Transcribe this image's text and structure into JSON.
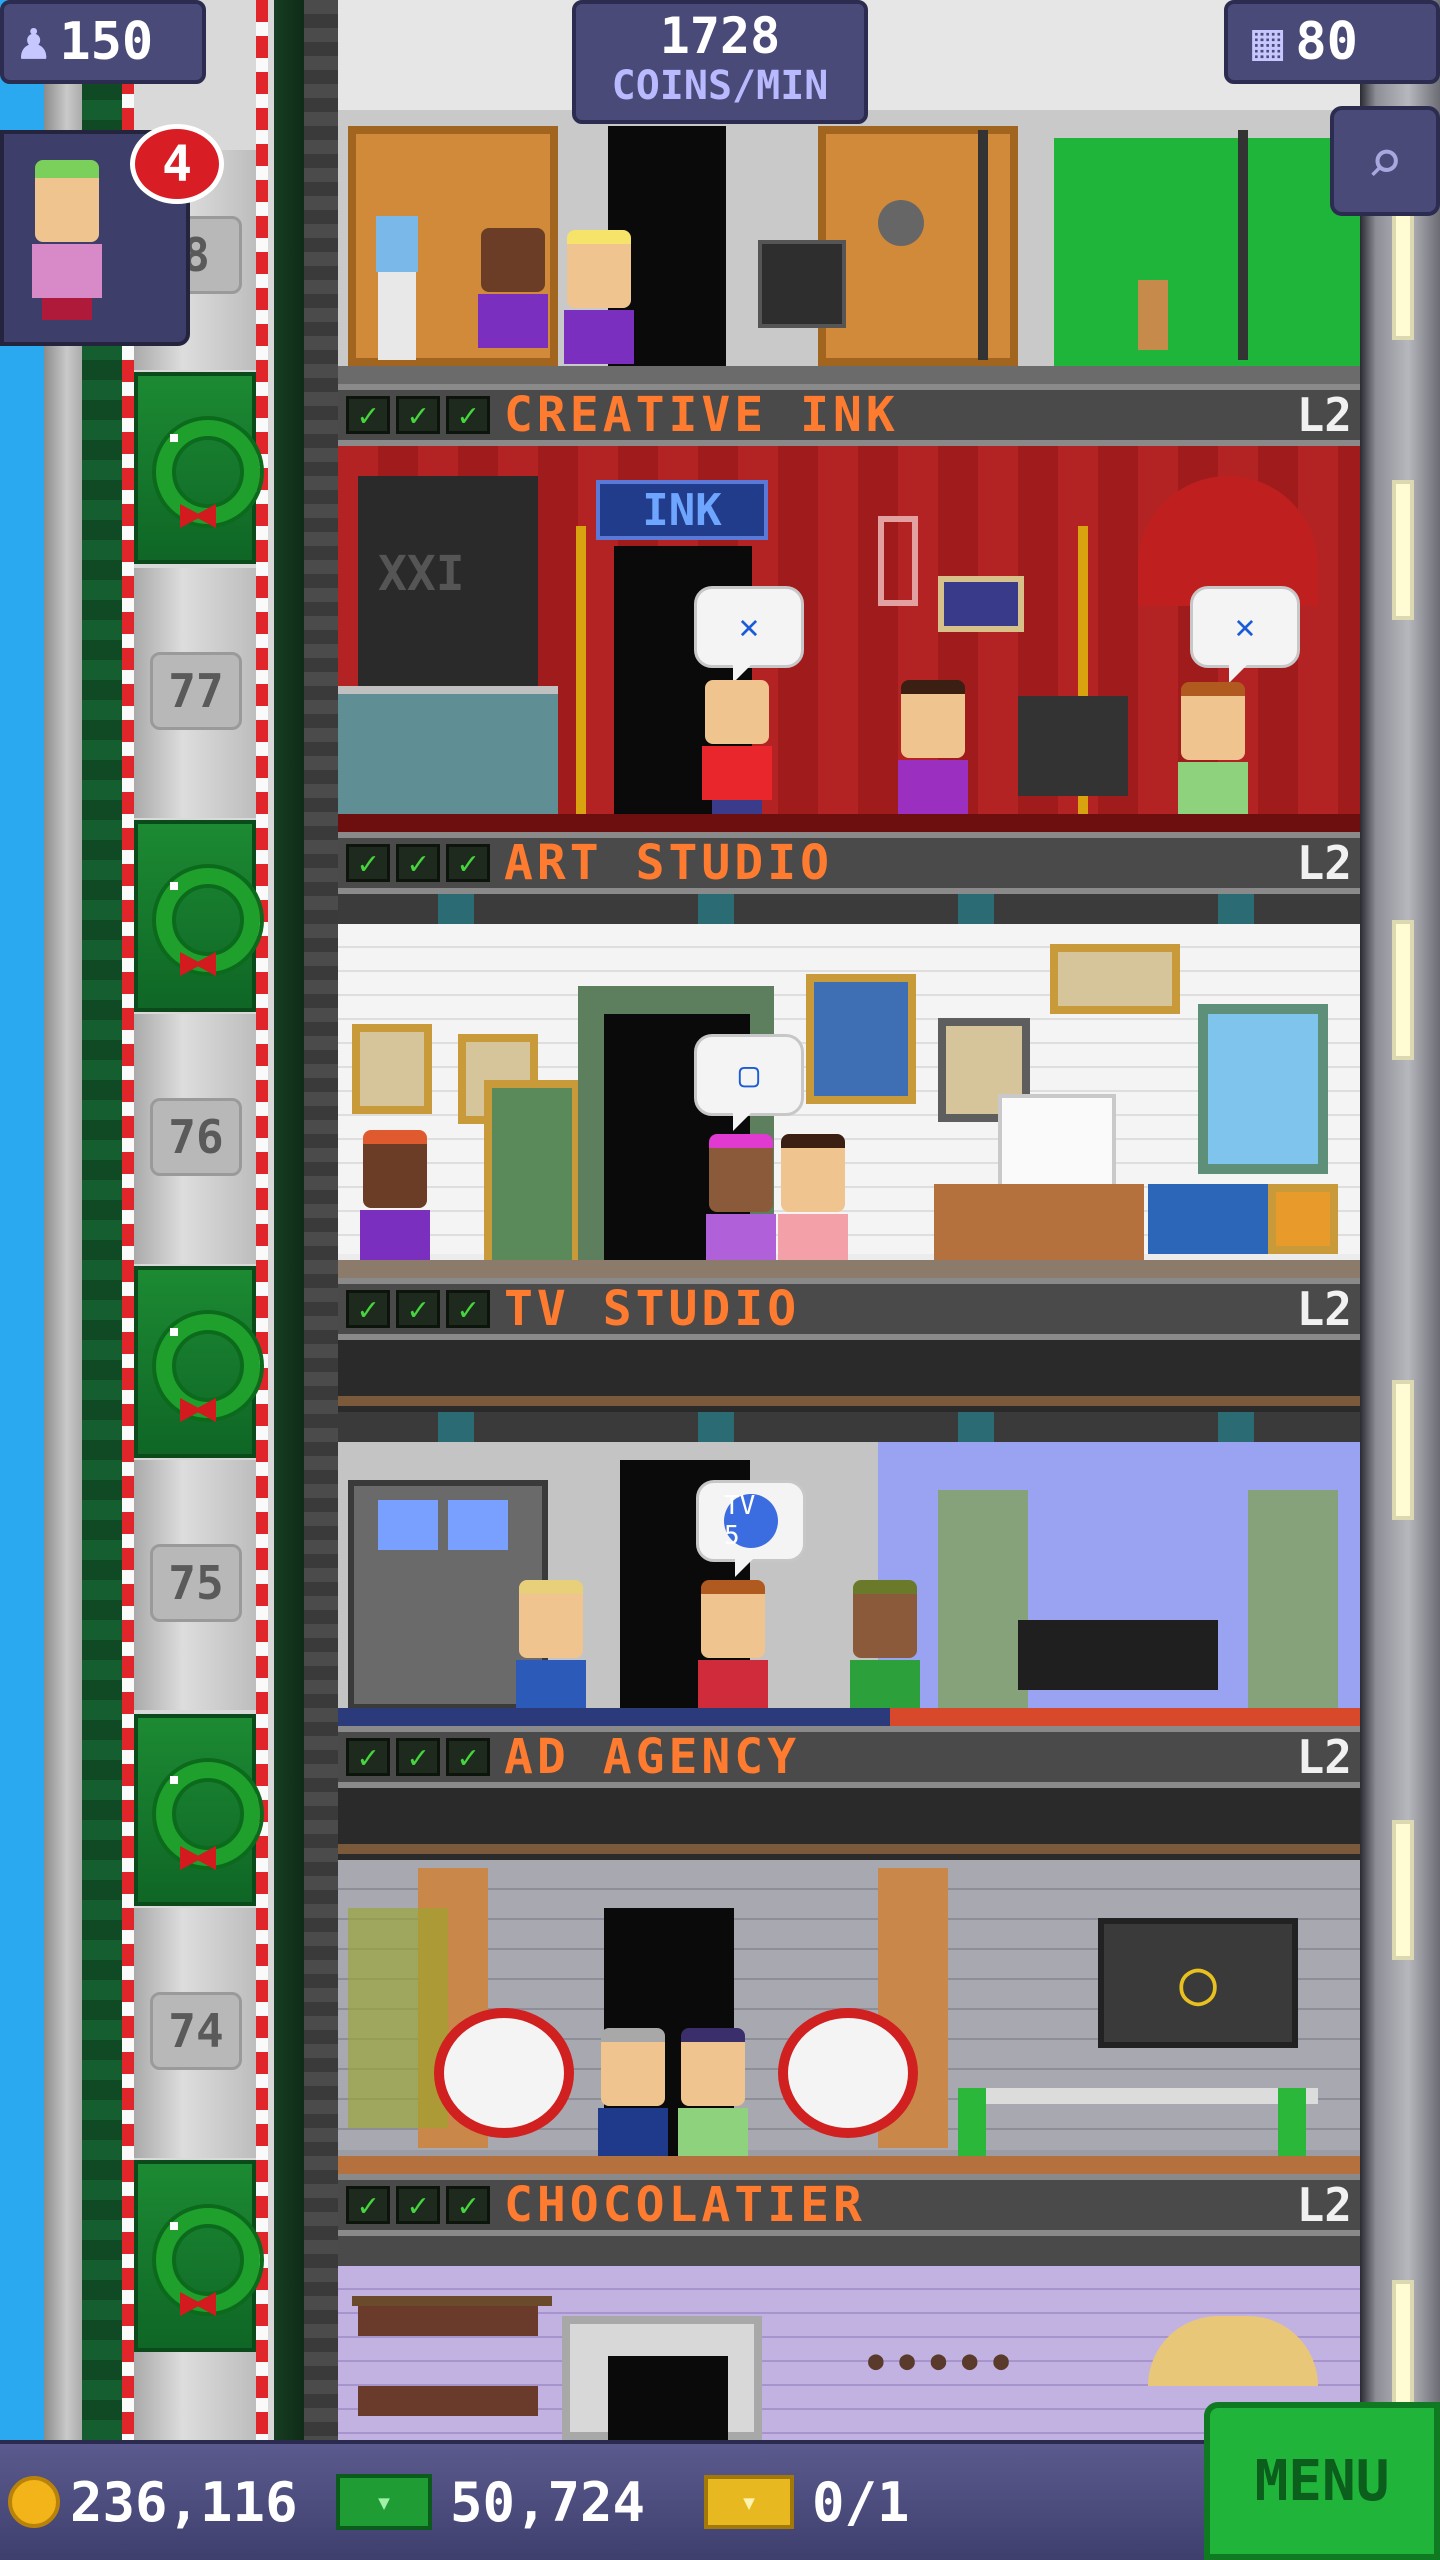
{
  "hud": {
    "population": "150",
    "population_icon": "person-icon",
    "coins_rate_value": "1728",
    "coins_rate_unit": "COINS/MIN",
    "floors": "80",
    "floors_icon": "building-icon",
    "search_icon": "magnifier-icon",
    "notifications": "4"
  },
  "elevator": {
    "floor_numbers": [
      "8",
      "77",
      "76",
      "75",
      "74"
    ]
  },
  "floors": [
    {
      "name": "CREATIVE INK",
      "level": "L2",
      "stars": 3
    },
    {
      "name": "ART STUDIO",
      "level": "L2",
      "stars": 3
    },
    {
      "name": "TV STUDIO",
      "level": "L2",
      "stars": 3
    },
    {
      "name": "AD AGENCY",
      "level": "L2",
      "stars": 3
    },
    {
      "name": "CHOCOLATIER",
      "level": "L2",
      "stars": 3
    }
  ],
  "rooms": {
    "top_sign": "",
    "ink_sign": "INK",
    "xxi_sign": "XXI",
    "tv_bubble": "TV 5"
  },
  "bottom": {
    "coins": "236,116",
    "bux": "50,724",
    "tickets": "0/1",
    "menu": "MENU"
  },
  "colors": {
    "accent_orange": "#ff7b2f",
    "check_green": "#45d53c",
    "hud_purple": "#4a4a78",
    "menu_green": "#21b43a",
    "candy_red": "#e0262b"
  }
}
